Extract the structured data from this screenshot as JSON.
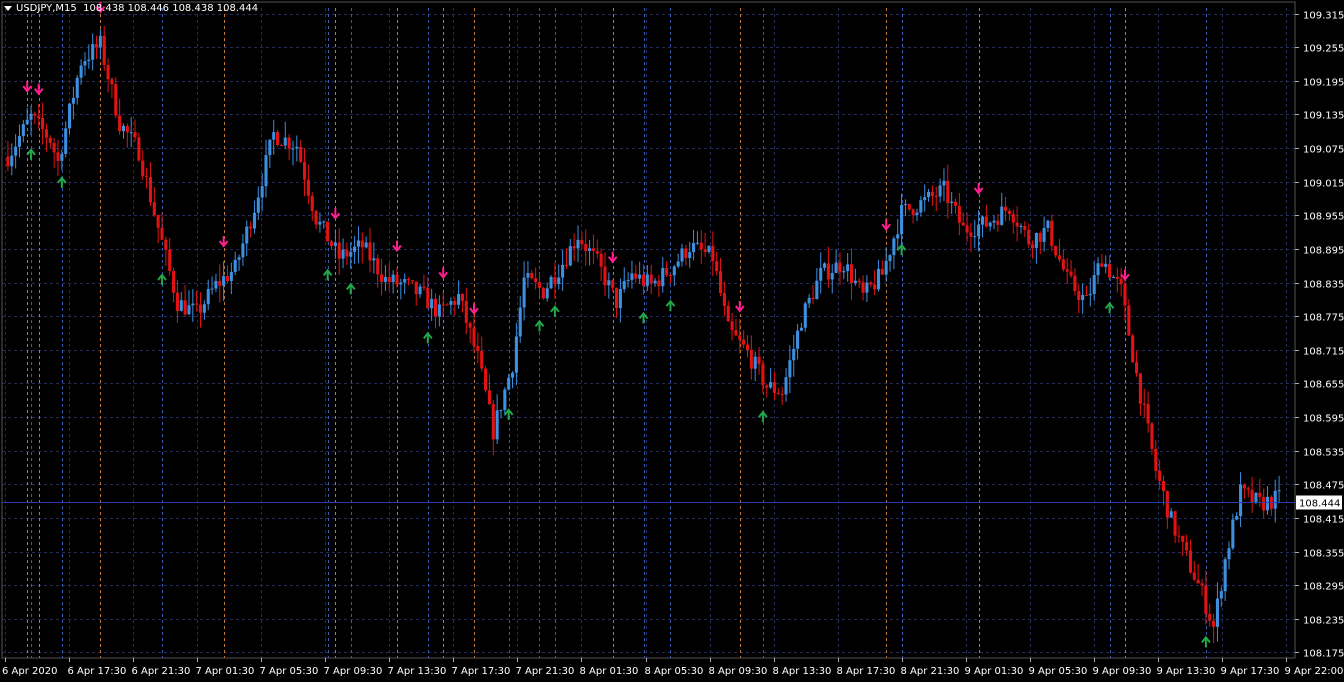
{
  "header": {
    "symbol": "USDJPY,M15",
    "ohlc": "108.438 108.446 108.438 108.444"
  },
  "colors": {
    "background": "#000000",
    "bull": "#3d8fe0",
    "bear": "#e31313",
    "grid": "#262c5a",
    "axis_text": "#ffffff",
    "vline_blue": "#3b67c8",
    "vline_orange": "#d3853a",
    "arrow_down": "#ff1f8f",
    "arrow_up": "#22a84a",
    "price_line": "#2a3aa8"
  },
  "chart_data": {
    "type": "candlestick",
    "timeframe": "M15",
    "ylim": [
      108.165,
      109.325
    ],
    "y_ticks": [
      "109.315",
      "109.255",
      "109.195",
      "109.135",
      "109.075",
      "109.015",
      "108.955",
      "108.895",
      "108.835",
      "108.775",
      "108.715",
      "108.655",
      "108.595",
      "108.535",
      "108.475",
      "108.415",
      "108.355",
      "108.295",
      "108.235",
      "108.175"
    ],
    "x_ticks": [
      "6 Apr 2020",
      "6 Apr 17:30",
      "6 Apr 21:30",
      "7 Apr 01:30",
      "7 Apr 05:30",
      "7 Apr 09:30",
      "7 Apr 13:30",
      "7 Apr 17:30",
      "7 Apr 21:30",
      "8 Apr 01:30",
      "8 Apr 05:30",
      "8 Apr 09:30",
      "8 Apr 13:30",
      "8 Apr 17:30",
      "8 Apr 21:30",
      "9 Apr 01:30",
      "9 Apr 05:30",
      "9 Apr 09:30",
      "9 Apr 13:30",
      "9 Apr 17:30",
      "9 Apr 22:00"
    ],
    "current_price": 108.444,
    "current_price_label": "108.444",
    "path": [
      [
        0,
        109.06
      ],
      [
        6,
        109.13
      ],
      [
        11,
        109.09
      ],
      [
        13,
        109.05
      ],
      [
        19,
        109.23
      ],
      [
        24,
        109.26
      ],
      [
        29,
        109.12
      ],
      [
        34,
        109.07
      ],
      [
        38,
        108.96
      ],
      [
        44,
        108.8
      ],
      [
        49,
        108.78
      ],
      [
        54,
        108.83
      ],
      [
        59,
        108.86
      ],
      [
        64,
        108.97
      ],
      [
        69,
        109.1
      ],
      [
        75,
        109.08
      ],
      [
        80,
        108.95
      ],
      [
        86,
        108.88
      ],
      [
        92,
        108.9
      ],
      [
        98,
        108.84
      ],
      [
        103,
        108.83
      ],
      [
        108,
        108.81
      ],
      [
        112,
        108.78
      ],
      [
        117,
        108.81
      ],
      [
        122,
        108.7
      ],
      [
        126,
        108.57
      ],
      [
        131,
        108.69
      ],
      [
        134,
        108.84
      ],
      [
        139,
        108.82
      ],
      [
        144,
        108.87
      ],
      [
        148,
        108.92
      ],
      [
        153,
        108.87
      ],
      [
        158,
        108.8
      ],
      [
        162,
        108.85
      ],
      [
        167,
        108.83
      ],
      [
        172,
        108.86
      ],
      [
        177,
        108.9
      ],
      [
        183,
        108.88
      ],
      [
        187,
        108.75
      ],
      [
        192,
        108.71
      ],
      [
        197,
        108.65
      ],
      [
        201,
        108.64
      ],
      [
        206,
        108.77
      ],
      [
        211,
        108.85
      ],
      [
        217,
        108.87
      ],
      [
        222,
        108.81
      ],
      [
        227,
        108.85
      ],
      [
        232,
        108.96
      ],
      [
        238,
        108.98
      ],
      [
        243,
        109.0
      ],
      [
        248,
        108.93
      ],
      [
        254,
        108.94
      ],
      [
        260,
        108.97
      ],
      [
        265,
        108.91
      ],
      [
        270,
        108.93
      ],
      [
        275,
        108.84
      ],
      [
        280,
        108.8
      ],
      [
        284,
        108.88
      ],
      [
        289,
        108.82
      ],
      [
        293,
        108.67
      ],
      [
        298,
        108.5
      ],
      [
        302,
        108.41
      ],
      [
        305,
        108.36
      ],
      [
        310,
        108.28
      ],
      [
        313,
        108.22
      ],
      [
        316,
        108.34
      ],
      [
        320,
        108.46
      ],
      [
        325,
        108.44
      ],
      [
        330,
        108.45
      ]
    ],
    "signals": [
      {
        "type": "down",
        "t": 5
      },
      {
        "type": "down",
        "t": 8
      },
      {
        "type": "up",
        "t": 6
      },
      {
        "type": "up",
        "t": 14
      },
      {
        "type": "down",
        "t": 24
      },
      {
        "type": "up",
        "t": 40
      },
      {
        "type": "down",
        "t": 56
      },
      {
        "type": "up",
        "t": 83
      },
      {
        "type": "down",
        "t": 85
      },
      {
        "type": "up",
        "t": 89
      },
      {
        "type": "down",
        "t": 101
      },
      {
        "type": "up",
        "t": 109
      },
      {
        "type": "down",
        "t": 113
      },
      {
        "type": "down",
        "t": 121
      },
      {
        "type": "up",
        "t": 130
      },
      {
        "type": "up",
        "t": 138
      },
      {
        "type": "up",
        "t": 142
      },
      {
        "type": "down",
        "t": 157
      },
      {
        "type": "up",
        "t": 165
      },
      {
        "type": "up",
        "t": 172
      },
      {
        "type": "down",
        "t": 190
      },
      {
        "type": "up",
        "t": 196
      },
      {
        "type": "down",
        "t": 228
      },
      {
        "type": "up",
        "t": 232
      },
      {
        "type": "down",
        "t": 252
      },
      {
        "type": "up",
        "t": 286
      },
      {
        "type": "down",
        "t": 290
      },
      {
        "type": "up",
        "t": 311
      }
    ]
  }
}
